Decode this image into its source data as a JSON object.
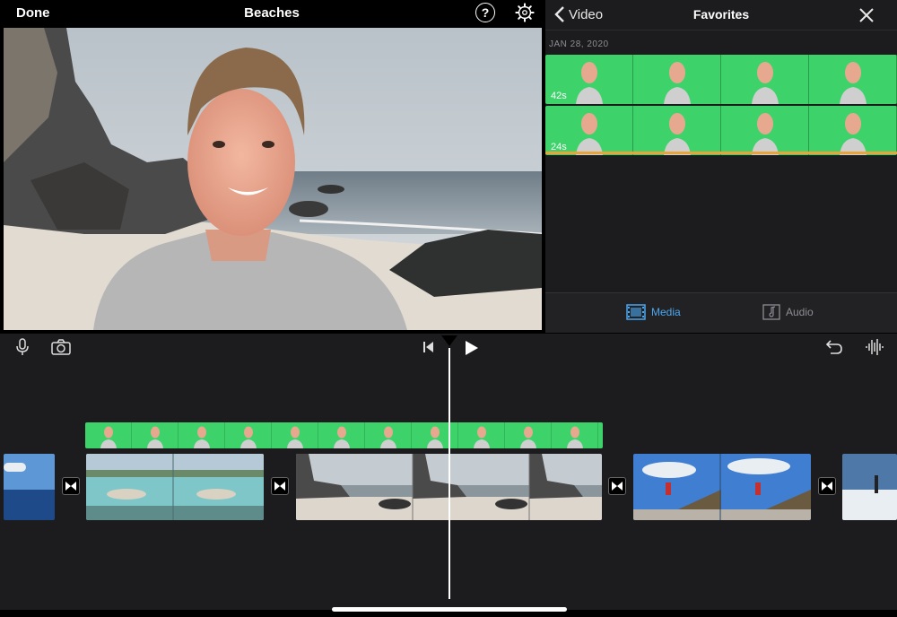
{
  "viewer": {
    "done_label": "Done",
    "project_title": "Beaches",
    "help_label": "?"
  },
  "browser": {
    "back_label": "Video",
    "title": "Favorites",
    "date": "JAN 28, 2020",
    "clips": [
      {
        "duration": "42s"
      },
      {
        "duration": "24s"
      }
    ],
    "tabs": {
      "media": "Media",
      "audio": "Audio"
    }
  },
  "colors": {
    "accent": "#4aa7f0",
    "green_screen": "#3dd36a",
    "background": "#1c1c1e"
  }
}
